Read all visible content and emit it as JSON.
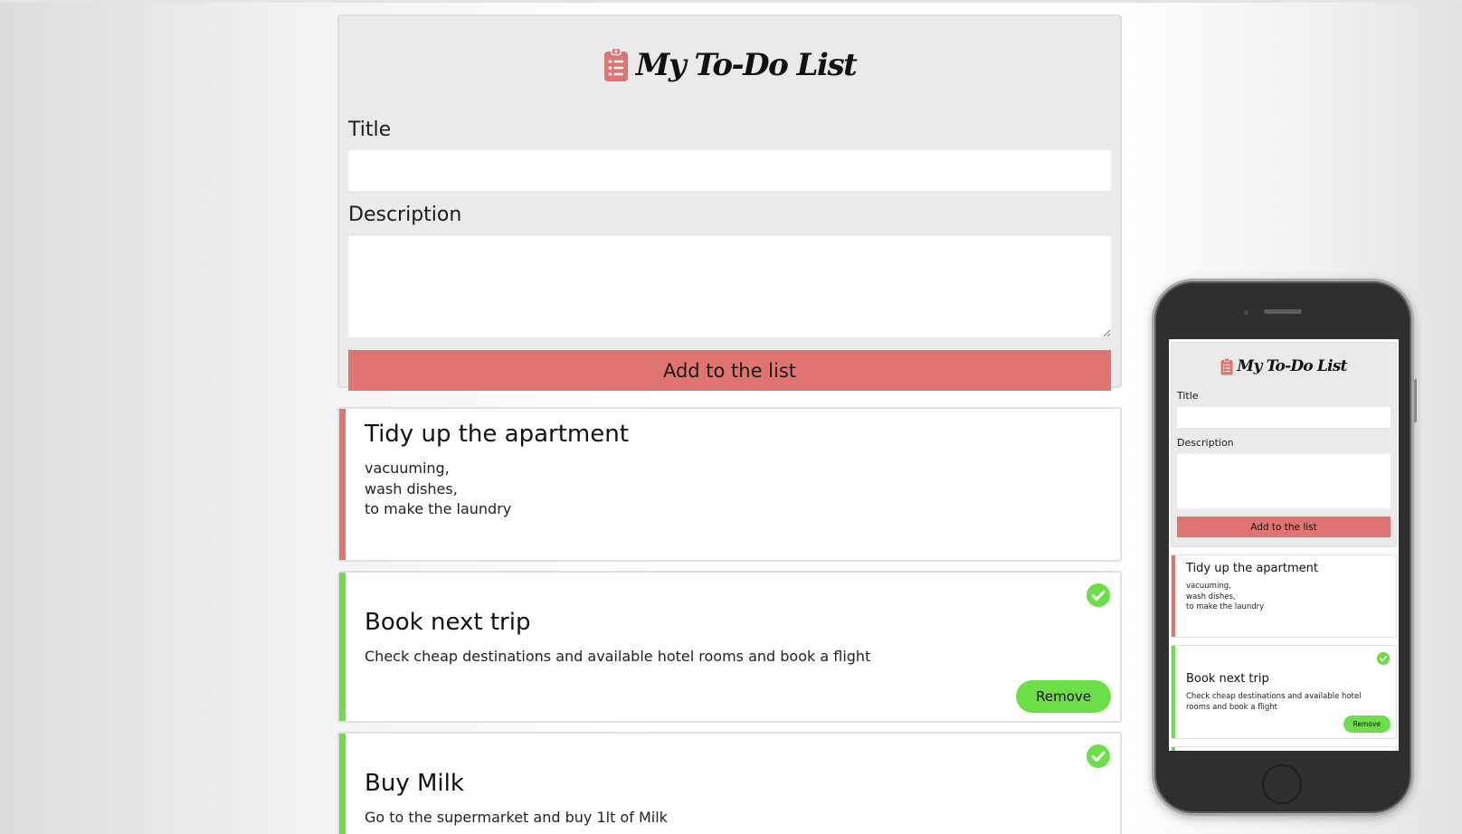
{
  "app": {
    "title": "My To-Do List",
    "title_label": "Title",
    "description_label": "Description",
    "title_value": "",
    "description_value": "",
    "add_button_label": "Add to the list"
  },
  "tasks": [
    {
      "title": "Tidy up the apartment",
      "description": "vacuuming,\nwash dishes,\nto make the laundry",
      "completed": false
    },
    {
      "title": "Book next trip",
      "description": "Check cheap destinations and available hotel rooms and book a flight",
      "completed": true,
      "remove_label": "Remove"
    },
    {
      "title": "Buy Milk",
      "description": "Go to the supermarket and buy 1lt of Milk",
      "completed": true
    }
  ],
  "mobile_preview": {
    "title": "My To-Do List",
    "title_label": "Title",
    "description_label": "Description",
    "add_button_label": "Add to the list",
    "tasks": [
      {
        "title": "Tidy up the apartment",
        "description": "vacuuming,\nwash dishes,\nto make the laundry",
        "completed": false
      },
      {
        "title": "Book next trip",
        "description": "Check cheap destinations and available hotel\nrooms and book a flight",
        "completed": true,
        "remove_label": "Remove"
      }
    ]
  },
  "colors": {
    "accent_red": "#e07470",
    "accent_green": "#6bde48",
    "form_background": "#eaeaea"
  },
  "icons": {
    "header": "clipboard-list-icon",
    "completed": "check-circle-icon"
  }
}
